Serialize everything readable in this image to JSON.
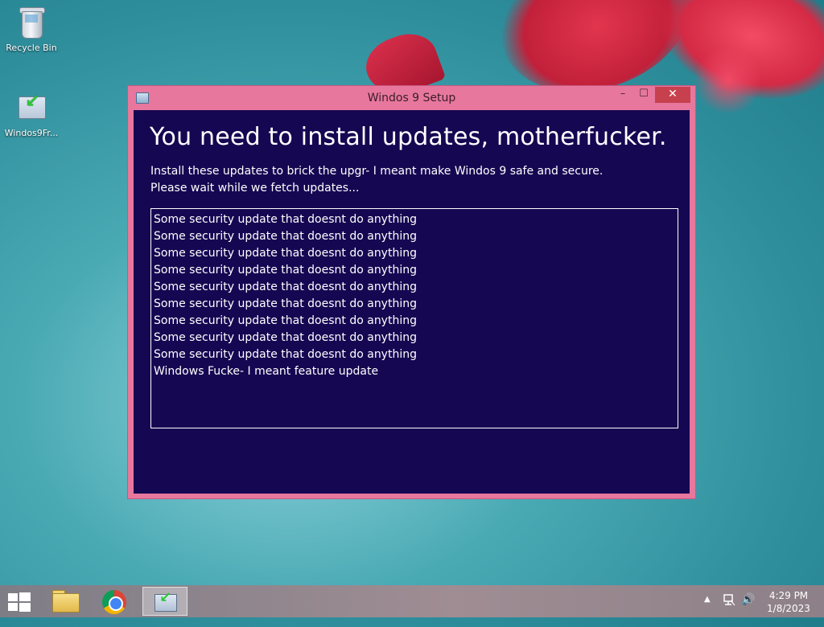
{
  "desktop": {
    "icons": [
      {
        "label": "Recycle Bin",
        "icon": "recycle-bin-icon"
      },
      {
        "label": "Windos9Fr...",
        "icon": "setup-installer-icon"
      }
    ]
  },
  "window": {
    "title": "Windos 9 Setup",
    "controls": {
      "minimize": "–",
      "maximize": "☐",
      "close": "✕"
    },
    "heading": "You need to install updates, motherfucker.",
    "subtitle_line1": "Install these updates to brick the upgr- I meant make Windos 9 safe and secure.",
    "subtitle_line2": "Please wait while we fetch updates...",
    "updates": [
      "Some security update that doesnt do anything",
      "Some security update that doesnt do anything",
      "Some security update that doesnt do anything",
      "Some security update that doesnt do anything",
      "Some security update that doesnt do anything",
      "Some security update that doesnt do anything",
      "Some security update that doesnt do anything",
      "Some security update that doesnt do anything",
      "Some security update that doesnt do anything",
      "Windows Fucke- I meant feature update"
    ]
  },
  "taskbar": {
    "apps": [
      {
        "icon": "file-explorer-icon"
      },
      {
        "icon": "chrome-icon"
      },
      {
        "icon": "setup-installer-icon",
        "active": true
      }
    ],
    "tray": {
      "show_hidden": "▲",
      "volume": "🔊"
    },
    "clock": {
      "time": "4:29 PM",
      "date": "1/8/2023"
    }
  },
  "colors": {
    "window_frame": "#e8779d",
    "window_client": "#160752",
    "close_button": "#c7404e"
  }
}
